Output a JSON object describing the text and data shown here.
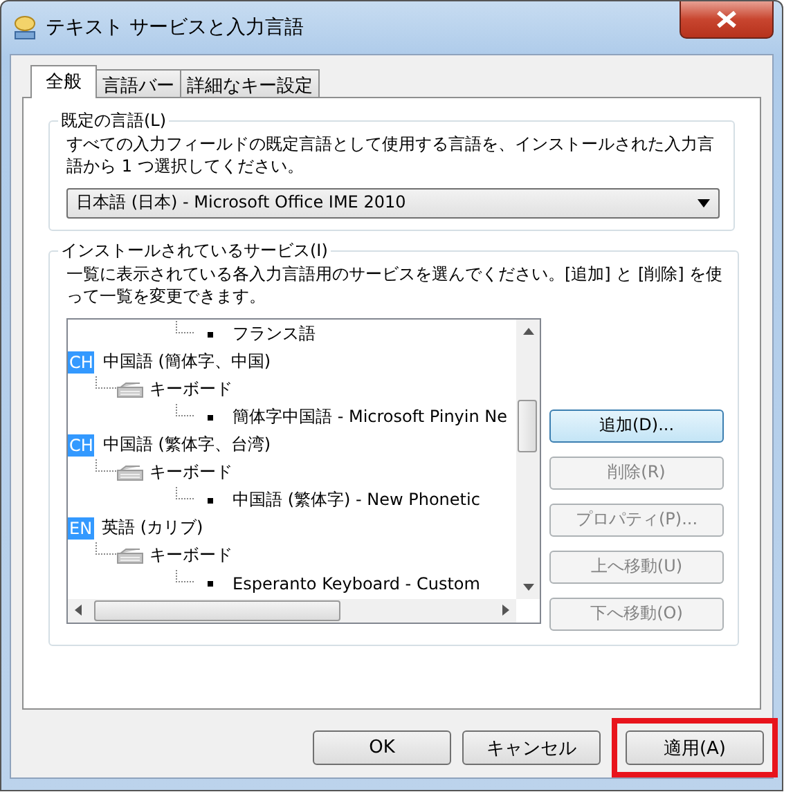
{
  "window": {
    "title": "テキスト サービスと入力言語"
  },
  "tabs": [
    {
      "label": "全般",
      "selected": true
    },
    {
      "label": "言語バー",
      "selected": false
    },
    {
      "label": "詳細なキー設定",
      "selected": false
    }
  ],
  "default_language": {
    "heading": "既定の言語(L)",
    "description": "すべての入力フィールドの既定言語として使用する言語を、インストールされた入力言語から 1 つ選択してください。",
    "dropdown_value": "日本語 (日本) - Microsoft Office IME 2010"
  },
  "installed_services": {
    "heading": "インストールされているサービス(I)",
    "description": "一覧に表示されている各入力言語用のサービスを選んでください。[追加] と [削除] を使って一覧を変更できます。",
    "tree": [
      {
        "kind": "layout",
        "label": "フランス語"
      },
      {
        "kind": "language",
        "badge": "CH",
        "label": "中国語 (簡体字、中国)",
        "children": [
          {
            "kind": "category",
            "label": "キーボード",
            "children": [
              {
                "kind": "layout",
                "label": "簡体字中国語 - Microsoft Pinyin Ne"
              }
            ]
          }
        ]
      },
      {
        "kind": "language",
        "badge": "CH",
        "label": "中国語 (繁体字、台湾)",
        "children": [
          {
            "kind": "category",
            "label": "キーボード",
            "children": [
              {
                "kind": "layout",
                "label": "中国語 (繁体字) - New Phonetic"
              }
            ]
          }
        ]
      },
      {
        "kind": "language",
        "badge": "EN",
        "label": "英語 (カリブ)",
        "children": [
          {
            "kind": "category",
            "label": "キーボード",
            "children": [
              {
                "kind": "layout",
                "label": "Esperanto Keyboard - Custom"
              }
            ]
          }
        ]
      }
    ],
    "buttons": [
      {
        "label": "追加(D)...",
        "disabled": false,
        "default": true
      },
      {
        "label": "削除(R)",
        "disabled": true,
        "default": false
      },
      {
        "label": "プロパティ(P)...",
        "disabled": true,
        "default": false
      },
      {
        "label": "上へ移動(U)",
        "disabled": true,
        "default": false
      },
      {
        "label": "下へ移動(O)",
        "disabled": true,
        "default": false
      }
    ]
  },
  "footer_buttons": [
    {
      "label": "OK",
      "highlighted": false
    },
    {
      "label": "キャンセル",
      "highlighted": false
    },
    {
      "label": "適用(A)",
      "highlighted": true
    }
  ]
}
